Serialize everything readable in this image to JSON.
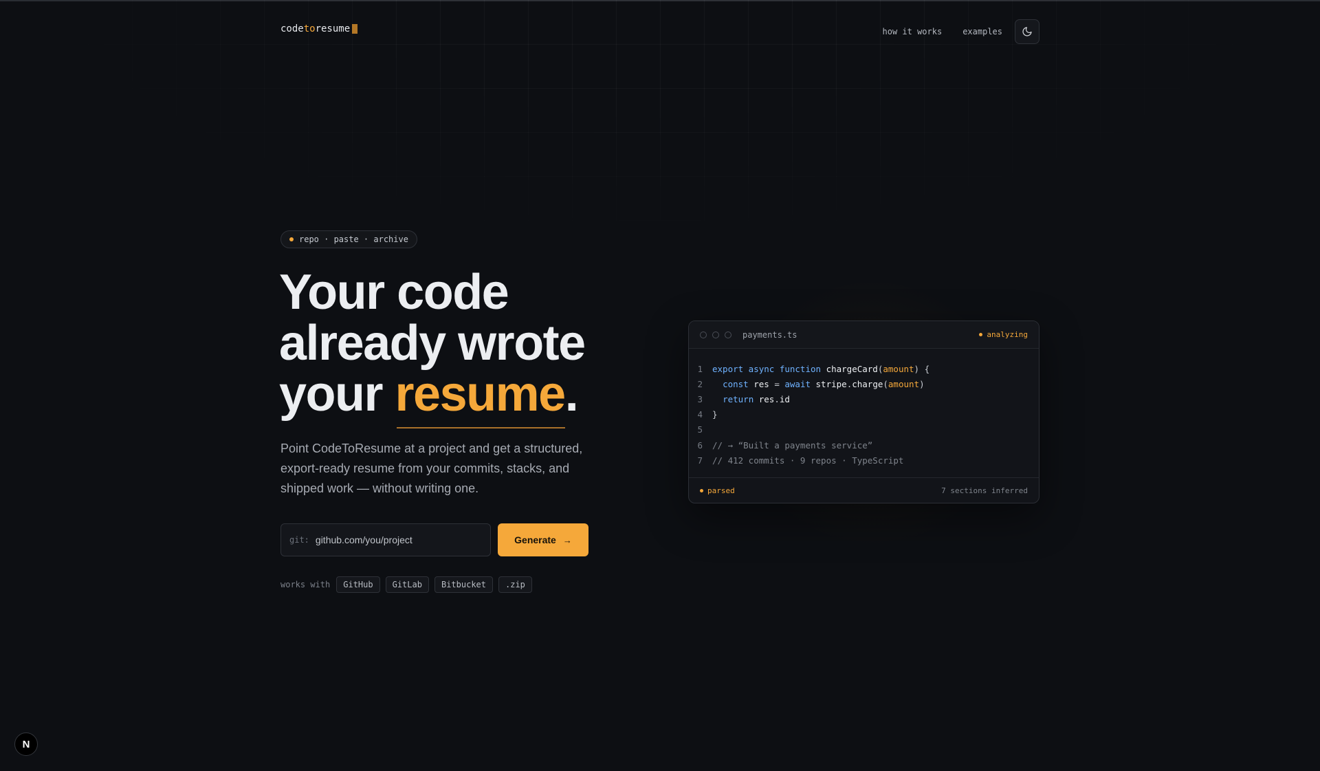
{
  "brand": {
    "part1": "code",
    "part2": "to",
    "part3": "resume"
  },
  "nav": {
    "how_it_works": "how it works",
    "examples": "examples",
    "theme_icon": "moon-icon"
  },
  "hero": {
    "chip": "repo · paste · archive",
    "headline_line1": "Your code",
    "headline_line2": "already wrote",
    "headline_line3_prefix": "your ",
    "headline_highlight": "resume",
    "headline_suffix": ".",
    "subtitle": "Point CodeToResume at a project and get a structured, export-ready resume from your commits, stacks, and shipped work — without writing one.",
    "input_prefix": "git:",
    "input_placeholder": "github.com/you/project",
    "generate_label": "Generate",
    "generate_arrow": "→",
    "works_with_label": "works with",
    "providers": [
      "GitHub",
      "GitLab",
      "Bitbucket",
      ".zip"
    ]
  },
  "code_card": {
    "filename": "payments.ts",
    "status": "analyzing",
    "lines": [
      {
        "n": "1",
        "tokens": [
          [
            "kw",
            "export async function "
          ],
          [
            "fn",
            "chargeCard"
          ],
          [
            "pl",
            "("
          ],
          [
            "arg",
            "amount"
          ],
          [
            "pl",
            ") {"
          ]
        ]
      },
      {
        "n": "2",
        "tokens": [
          [
            "pl",
            "  "
          ],
          [
            "kw",
            "const "
          ],
          [
            "fn",
            "res"
          ],
          [
            "pl",
            " = "
          ],
          [
            "kw",
            "await "
          ],
          [
            "fn",
            "stripe"
          ],
          [
            "pl",
            "."
          ],
          [
            "fn",
            "charge"
          ],
          [
            "pl",
            "("
          ],
          [
            "arg",
            "amount"
          ],
          [
            "pl",
            ")"
          ]
        ]
      },
      {
        "n": "3",
        "tokens": [
          [
            "pl",
            "  "
          ],
          [
            "kw",
            "return "
          ],
          [
            "fn",
            "res"
          ],
          [
            "pl",
            "."
          ],
          [
            "fn",
            "id"
          ]
        ]
      },
      {
        "n": "4",
        "tokens": [
          [
            "pl",
            "}"
          ]
        ]
      },
      {
        "n": "5",
        "tokens": []
      },
      {
        "n": "6",
        "tokens": [
          [
            "cm",
            "// → “Built a payments service”"
          ]
        ]
      },
      {
        "n": "7",
        "tokens": [
          [
            "cm",
            "// 412 commits · 9 repos · TypeScript"
          ]
        ]
      }
    ],
    "footer_status": "parsed",
    "footer_right": "7 sections inferred"
  },
  "badge": {
    "label": "N"
  },
  "colors": {
    "accent": "#f5a83a",
    "background": "#0d0f13",
    "keyword": "#6fb2ff"
  }
}
